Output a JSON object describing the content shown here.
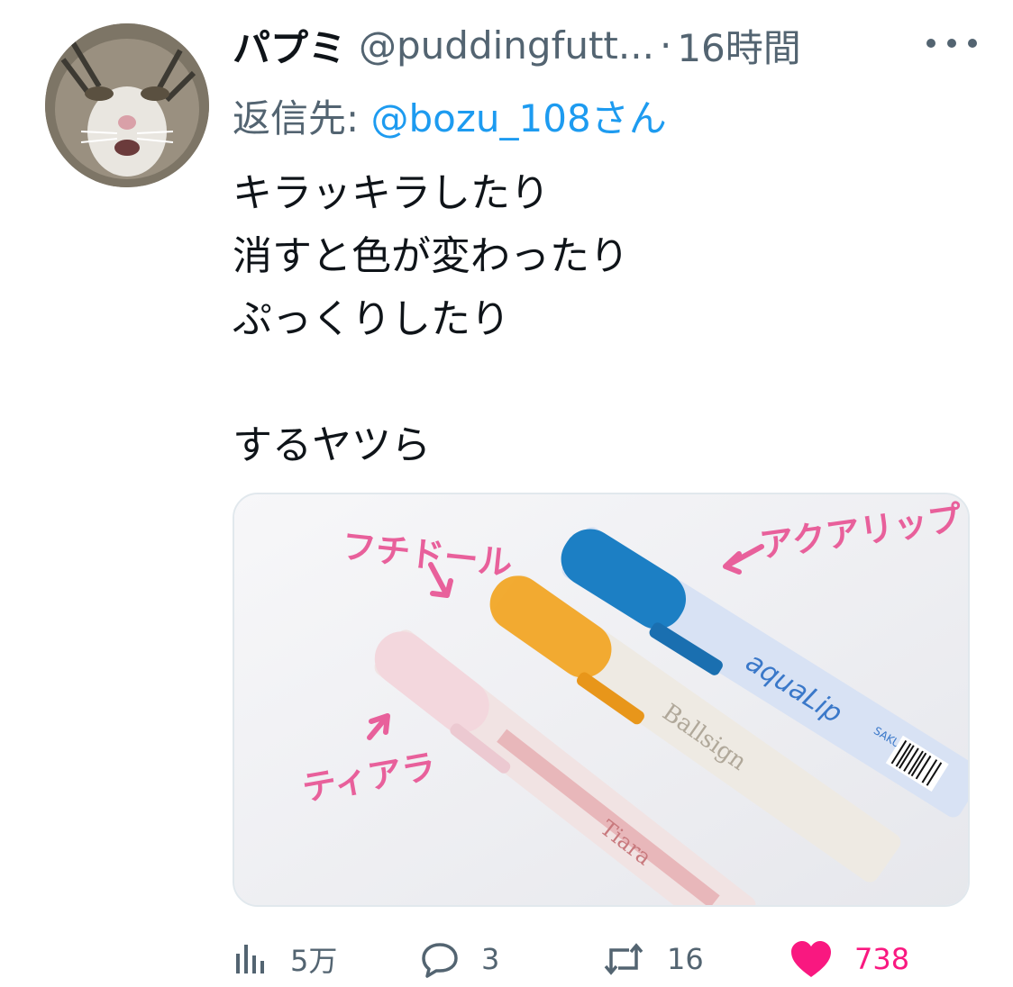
{
  "author": {
    "display_name": "パプミ",
    "handle": "@puddingfutt...",
    "separator": "·",
    "time": "16時間"
  },
  "reply": {
    "prefix": "返信先:",
    "mention": "@bozu_108さん"
  },
  "body": {
    "lines": [
      "キラッキラしたり",
      "消すと色が変わったり",
      "ぷっくりしたり",
      "",
      "するヤツら"
    ]
  },
  "media": {
    "labels": {
      "fuchidoru": "フチドール",
      "aquarip": "アクアリップ",
      "tiara": "ティアラ"
    },
    "pen_texts": {
      "aqualip": "aquaLip",
      "sakura": "SAKURA",
      "ballsign": "Ballsign",
      "tiara": "Tiara"
    },
    "colors": {
      "annotation": "#e8609b",
      "blue_cap": "#1c7fc4",
      "orange_cap": "#f2a31d",
      "pink_cap": "#f3d7dd"
    }
  },
  "actions": {
    "views": "5万",
    "replies": "3",
    "retweets": "16",
    "likes": "738"
  },
  "icons": {
    "views": "analytics-icon",
    "reply": "reply-icon",
    "retweet": "retweet-icon",
    "like": "heart-icon",
    "more": "more-icon"
  }
}
